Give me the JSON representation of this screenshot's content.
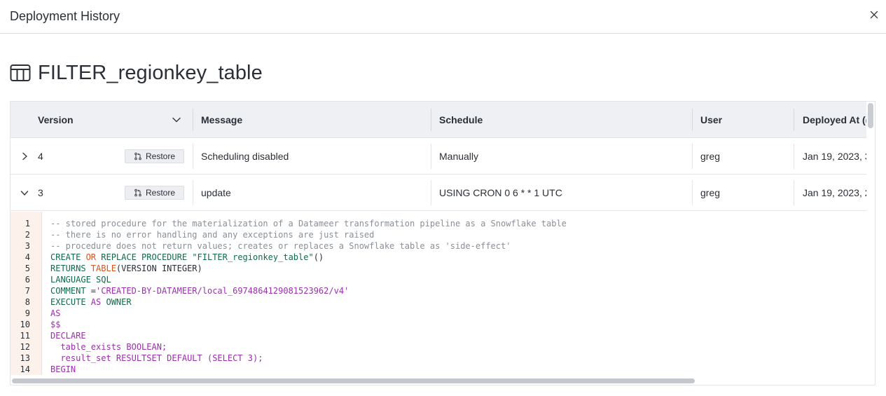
{
  "dialog": {
    "title": "Deployment History",
    "close_icon": "close-icon"
  },
  "page": {
    "title": "FILTER_regionkey_table",
    "icon": "table-icon"
  },
  "table": {
    "columns": [
      "Version",
      "Message",
      "Schedule",
      "User",
      "Deployed At (("
    ],
    "rows": [
      {
        "expanded": false,
        "version": "4",
        "restore_label": "Restore",
        "message": "Scheduling disabled",
        "schedule": "Manually",
        "user": "greg",
        "deployed_at": "Jan 19, 2023, 3"
      },
      {
        "expanded": true,
        "version": "3",
        "restore_label": "Restore",
        "message": "update",
        "schedule": "USING CRON 0 6 * * 1 UTC",
        "user": "greg",
        "deployed_at": "Jan 19, 2023, 2"
      }
    ]
  },
  "code": {
    "line_numbers": [
      "1",
      "2",
      "3",
      "4",
      "5",
      "6",
      "7",
      "8",
      "9",
      "10",
      "11",
      "12",
      "13",
      "14"
    ],
    "lines": [
      [
        {
          "t": "-- stored procedure for the materialization of a Datameer transformation pipeline as a Snowflake table",
          "c": "comment"
        }
      ],
      [
        {
          "t": "-- there is no error handling and any exceptions are just raised",
          "c": "comment"
        }
      ],
      [
        {
          "t": "-- procedure does not return values; creates or replaces a Snowflake table as 'side-effect'",
          "c": "comment"
        }
      ],
      [
        {
          "t": "CREATE ",
          "c": "kw"
        },
        {
          "t": "OR",
          "c": "type"
        },
        {
          "t": " REPLACE PROCEDURE ",
          "c": "kw"
        },
        {
          "t": "\"FILTER_regionkey_table\"",
          "c": "kw"
        },
        {
          "t": "()",
          "c": "op"
        }
      ],
      [
        {
          "t": "RETURNS ",
          "c": "kw"
        },
        {
          "t": "TABLE",
          "c": "type"
        },
        {
          "t": "(VERSION INTEGER)",
          "c": "op"
        }
      ],
      [
        {
          "t": "LANGUAGE SQL",
          "c": "kw"
        }
      ],
      [
        {
          "t": "COMMENT ",
          "c": "kw"
        },
        {
          "t": "=",
          "c": "op"
        },
        {
          "t": "'CREATED-BY-DATAMEER/local_6974864129081523962/v4'",
          "c": "str"
        }
      ],
      [
        {
          "t": "EXECUTE ",
          "c": "kw"
        },
        {
          "t": "AS",
          "c": "str"
        },
        {
          "t": " OWNER",
          "c": "kw"
        }
      ],
      [
        {
          "t": "AS",
          "c": "str"
        }
      ],
      [
        {
          "t": "$$",
          "c": "str"
        }
      ],
      [
        {
          "t": "DECLARE",
          "c": "str"
        }
      ],
      [
        {
          "t": "  table_exists BOOLEAN;",
          "c": "str"
        }
      ],
      [
        {
          "t": "  result_set RESULTSET DEFAULT (SELECT 3);",
          "c": "str"
        }
      ],
      [
        {
          "t": "BEGIN",
          "c": "str"
        }
      ]
    ]
  },
  "colors": {
    "accent_gutter": "#fdf1ec",
    "header_bg": "#eef0f3",
    "keyword": "#116a4a",
    "string": "#9b2fae",
    "comment": "#8a8f96",
    "type": "#d9541e"
  }
}
